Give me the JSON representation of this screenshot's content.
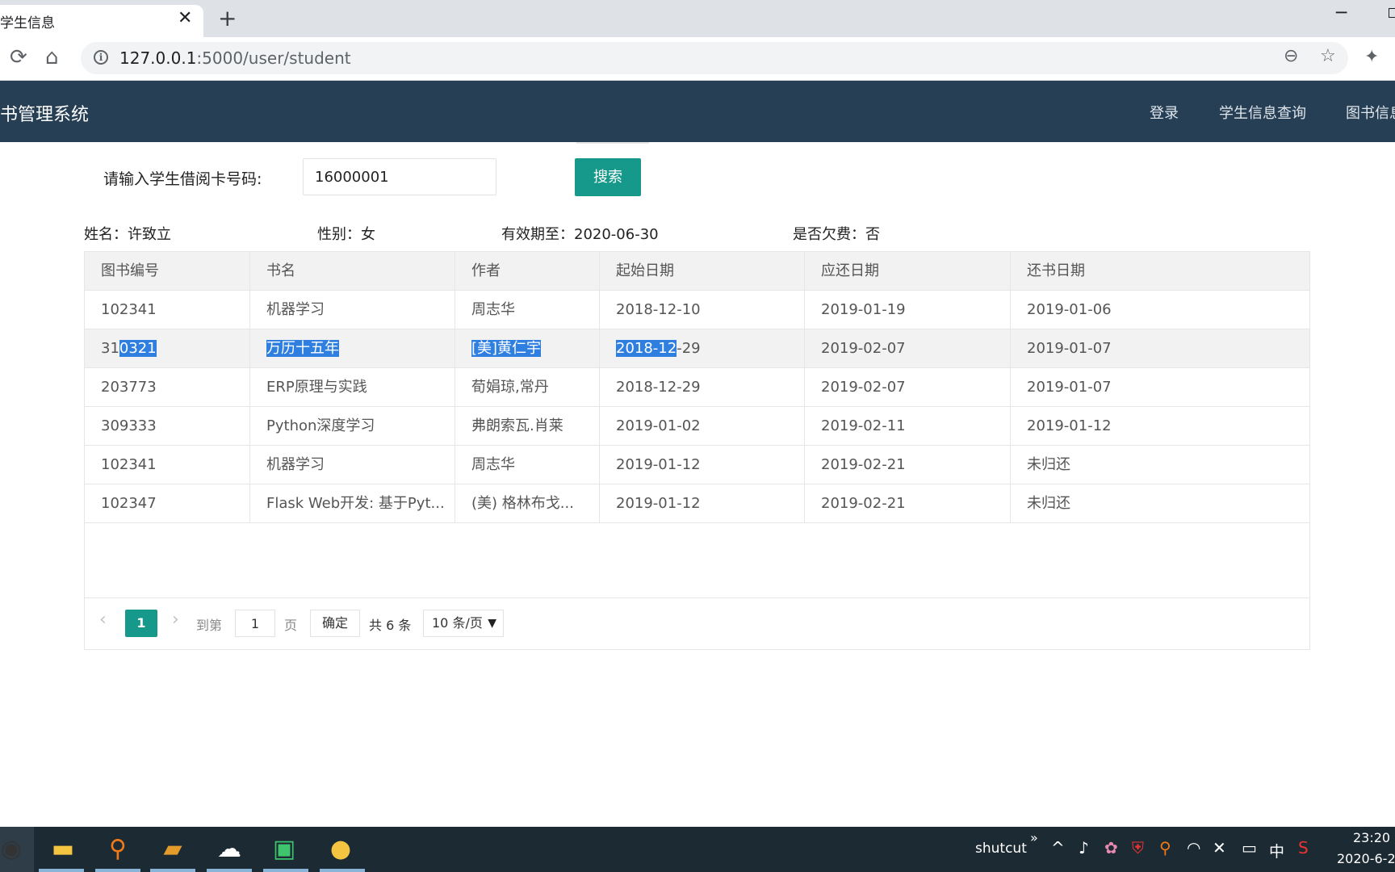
{
  "browser": {
    "tab_title": "学生信息",
    "tab_close": "✕",
    "new_tab": "+",
    "url_host": "127.0.0.1",
    "url_rest": ":5000/user/student"
  },
  "navbar": {
    "brand": "书管理系统",
    "items": [
      "登录",
      "学生信息查询",
      "图书信息"
    ]
  },
  "search": {
    "label": "请输入学生借阅卡号码:",
    "value": "16000001",
    "button": "搜索"
  },
  "student": {
    "name": "姓名：许致立",
    "gender": "性别：女",
    "valid_until": "有效期至：2020-06-30",
    "arrears": "是否欠费：否"
  },
  "table": {
    "headers": [
      "图书编号",
      "书名",
      "作者",
      "起始日期",
      "应还日期",
      "还书日期"
    ],
    "rows": [
      [
        "102341",
        "机器学习",
        "周志华",
        "2018-12-10",
        "2019-01-19",
        "2019-01-06"
      ],
      [
        "310321",
        "万历十五年",
        "[美]黄仁宇",
        "2018-12-29",
        "2019-02-07",
        "2019-01-07"
      ],
      [
        "203773",
        "ERP原理与实践",
        "荀娟琼,常丹",
        "2018-12-29",
        "2019-02-07",
        "2019-01-07"
      ],
      [
        "309333",
        "Python深度学习",
        "弗朗索瓦.肖莱",
        "2019-01-02",
        "2019-02-11",
        "2019-01-12"
      ],
      [
        "102341",
        "机器学习",
        "周志华",
        "2019-01-12",
        "2019-02-21",
        "未归还"
      ],
      [
        "102347",
        "Flask Web开发: 基于Pyt...",
        "(美) 格林布戈...",
        "2019-01-12",
        "2019-02-21",
        "未归还"
      ]
    ],
    "highlight_row": {
      "id_prefix": "31",
      "id_selected": "0321",
      "title_selected": "万历十五年",
      "author_selected": "[美]黄仁宇",
      "start_selected": "2018-12",
      "start_rest": "-29"
    }
  },
  "pagination": {
    "prev": "‹",
    "current": "1",
    "next": "›",
    "goto_label": "到第",
    "goto_value": "1",
    "page_label": "页",
    "confirm": "确定",
    "total": "共 6 条",
    "page_size": "10 条/页"
  },
  "taskbar": {
    "tray_app": "shutcut",
    "tray_more": "»",
    "ime": "中",
    "time": "23:20",
    "date": "2020-6-2"
  },
  "colors": {
    "navbar": "#263f55",
    "accent": "#16998a",
    "selection": "#2f7fe0",
    "taskbar": "#1c2a33"
  }
}
